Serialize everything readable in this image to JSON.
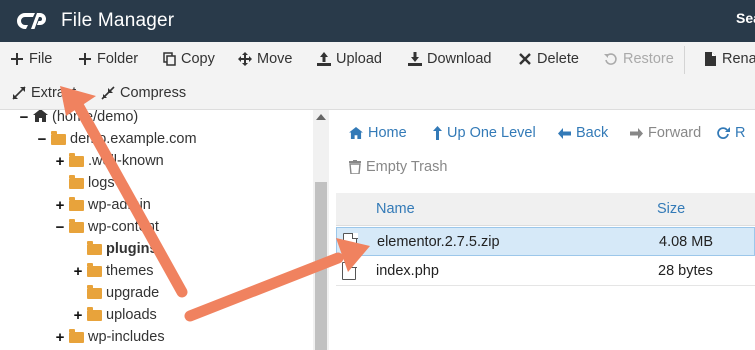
{
  "header": {
    "title": "File Manager",
    "search_partial": "Sea",
    "logo_icon": "cpanel-logo-icon"
  },
  "toolbar": {
    "row1": [
      {
        "id": "file",
        "label": "File",
        "icon": "plus-icon"
      },
      {
        "id": "folder",
        "label": "Folder",
        "icon": "plus-icon"
      },
      {
        "id": "copy",
        "label": "Copy",
        "icon": "copy-icon"
      },
      {
        "id": "move",
        "label": "Move",
        "icon": "move-icon"
      },
      {
        "id": "upload",
        "label": "Upload",
        "icon": "upload-icon"
      },
      {
        "id": "download",
        "label": "Download",
        "icon": "download-icon"
      },
      {
        "id": "delete",
        "label": "Delete",
        "icon": "close-icon"
      },
      {
        "id": "restore",
        "label": "Restore",
        "icon": "restore-icon",
        "disabled": true
      },
      {
        "id": "rename",
        "label": "Renar",
        "icon": "file-icon"
      }
    ],
    "row2": [
      {
        "id": "extract",
        "label": "Extract",
        "icon": "expand-icon"
      },
      {
        "id": "compress",
        "label": "Compress",
        "icon": "compress-icon"
      }
    ]
  },
  "tree": {
    "nodes": [
      {
        "label": "(home/demo)",
        "toggle": "−",
        "type": "home"
      },
      {
        "label": "demo.example.com",
        "toggle": "−",
        "type": "folder-open"
      },
      {
        "label": ".well-known",
        "toggle": "+",
        "type": "folder"
      },
      {
        "label": "logs",
        "toggle": "",
        "type": "folder"
      },
      {
        "label": "wp-admin",
        "toggle": "+",
        "type": "folder"
      },
      {
        "label": "wp-content",
        "toggle": "−",
        "type": "folder-open"
      },
      {
        "label": "plugins",
        "toggle": "",
        "type": "folder",
        "bold": true
      },
      {
        "label": "themes",
        "toggle": "+",
        "type": "folder"
      },
      {
        "label": "upgrade",
        "toggle": "",
        "type": "folder"
      },
      {
        "label": "uploads",
        "toggle": "+",
        "type": "folder"
      },
      {
        "label": "wp-includes",
        "toggle": "+",
        "type": "folder"
      }
    ]
  },
  "nav": {
    "home": "Home",
    "up_one_level": "Up One Level",
    "back": "Back",
    "forward": "Forward",
    "reload_partial": "R",
    "empty_trash": "Empty Trash"
  },
  "table": {
    "columns": {
      "name": "Name",
      "size": "Size"
    },
    "rows": [
      {
        "name": "elementor.2.7.5.zip",
        "size": "4.08 MB",
        "selected": true,
        "icon": "zip-file-icon"
      },
      {
        "name": "index.php",
        "size": "28 bytes",
        "selected": false,
        "icon": "code-file-icon"
      }
    ]
  },
  "colors": {
    "header_bg": "#293a4a",
    "link": "#337ab7",
    "folder": "#e8a33b",
    "selected_row": "#d6e9f8",
    "annotation_arrow": "#f0825f"
  }
}
